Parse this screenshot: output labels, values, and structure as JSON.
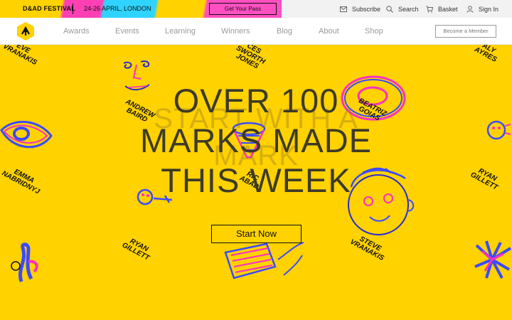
{
  "promo": {
    "title": "D&AD FESTIVAL",
    "date": "24-26 APRIL, LONDON",
    "pass_label": "Get Your Pass"
  },
  "utility": {
    "subscribe": "Subscribe",
    "search": "Search",
    "basket": "Basket",
    "signin": "Sign In"
  },
  "nav": {
    "items": [
      "Awards",
      "Events",
      "Learning",
      "Winners",
      "Blog",
      "About",
      "Shop"
    ],
    "member_label": "Become a Member"
  },
  "hero": {
    "ghost_line1": "START WITH A",
    "ghost_line2": "MARK",
    "headline_line1": "OVER 100",
    "headline_line2": "MARKS MADE",
    "headline_line3": "THIS WEEK",
    "cta_label": "Start Now",
    "names": {
      "steve_top": "EVE\nVRANAKIS",
      "ces": "CES\nSWORTH\nJONES",
      "aly": "ALY\nAYRES",
      "andrew": "ANDREW\nBAIRD",
      "beatriz": "BEATRIZ\nGOIAS",
      "emma": "EMMA\nNABRIDNYJ",
      "ric": "RIC\nABAD",
      "ryan_right": "RYAN\nGILLETT",
      "ryan_left": "RYAN\nGILLETT",
      "steve_bottom": "STEVE\nVRANAKIS"
    }
  },
  "colors": {
    "brand_yellow": "#ffd200",
    "doodle_blue": "#3b4bff",
    "doodle_pink": "#ff2fc2"
  }
}
